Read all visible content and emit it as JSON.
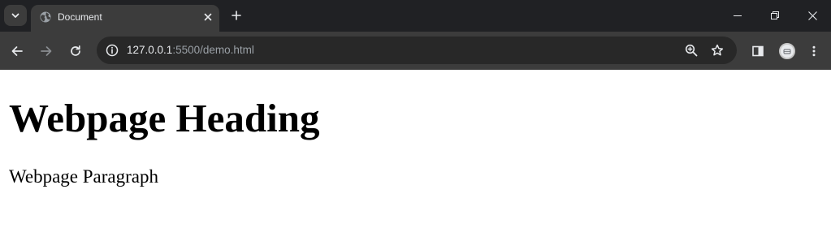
{
  "browser": {
    "tab": {
      "title": "Document"
    },
    "address_bar": {
      "url_host": "127.0.0.1",
      "url_rest": ":5500/demo.html"
    },
    "icons": {
      "tab_search": "chevron-down-icon",
      "favicon": "globe-icon",
      "tab_close": "close-icon",
      "new_tab": "plus-icon",
      "minimize": "minimize-icon",
      "restore": "restore-icon",
      "window_close": "close-icon",
      "back": "arrow-left-icon",
      "forward": "arrow-right-icon",
      "reload": "reload-icon",
      "site_info": "info-icon",
      "zoom": "zoom-in-icon",
      "bookmark": "star-icon",
      "side_panel": "side-panel-icon",
      "profile": "avatar-icon",
      "menu": "kebab-menu-icon"
    },
    "colors": {
      "tabstrip_bg": "#202124",
      "toolbar_bg": "#3c3c3c",
      "omnibox_bg": "#282828",
      "text_light": "#e8eaed",
      "text_dim": "#9aa0a6"
    }
  },
  "page": {
    "heading": "Webpage Heading",
    "paragraph": "Webpage Paragraph"
  }
}
